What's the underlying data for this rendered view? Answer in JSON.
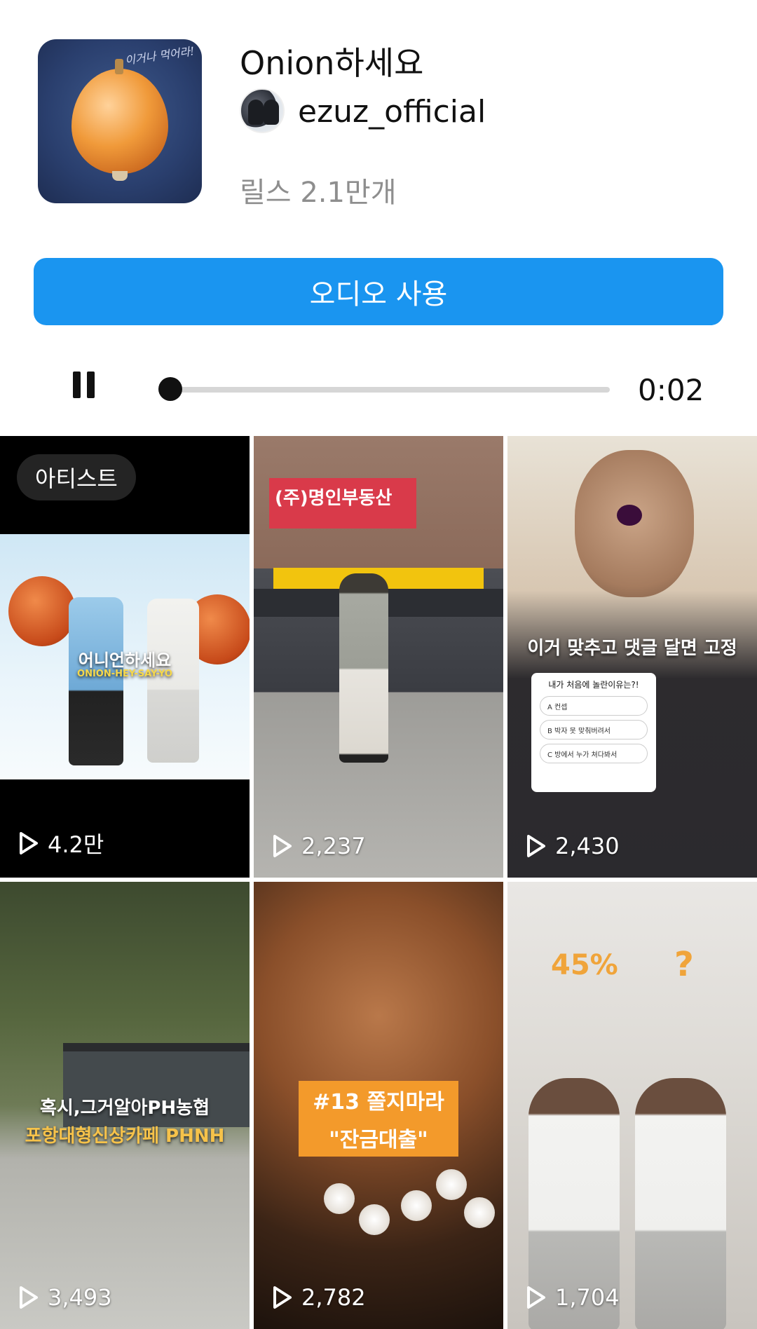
{
  "header": {
    "title": "Onion하세요",
    "artist": "ezuz_official",
    "reels_count": "릴스 2.1만개",
    "cover_text": "이거나\n먹어라!"
  },
  "actions": {
    "use_audio": "오디오 사용"
  },
  "player": {
    "time": "0:02",
    "progress": 0.0
  },
  "grid": {
    "tiles": [
      {
        "badge": "아티스트",
        "views": "4.2만",
        "overlay": "어니언하세요",
        "overlay_sub": "ONION-HEY-SAY-YO"
      },
      {
        "views": "2,237",
        "sign": "(주)명인부동산"
      },
      {
        "views": "2,430",
        "overlay": "이거 맞추고 댓글 달면 고정",
        "quiz_title": "내가 처음에 놀란이유는?!",
        "quiz_options": [
          "A  컨셉",
          "B  박자 못 맞춰버려서",
          "C  방에서 누가 쳐다봐서"
        ]
      },
      {
        "views": "3,493",
        "overlay_l1": "혹시,그거알아PH농협",
        "overlay_l2": "포항대형신상카페 PHNH"
      },
      {
        "views": "2,782",
        "overlay_l1": "#13 쫄지마라",
        "overlay_l2": "\"잔금대출\""
      },
      {
        "views": "1,704",
        "overlay_pct": "45%",
        "overlay_q": "?"
      }
    ]
  },
  "colors": {
    "accent": "#1a95f0",
    "text": "#111111",
    "muted": "#8e8e8e"
  }
}
